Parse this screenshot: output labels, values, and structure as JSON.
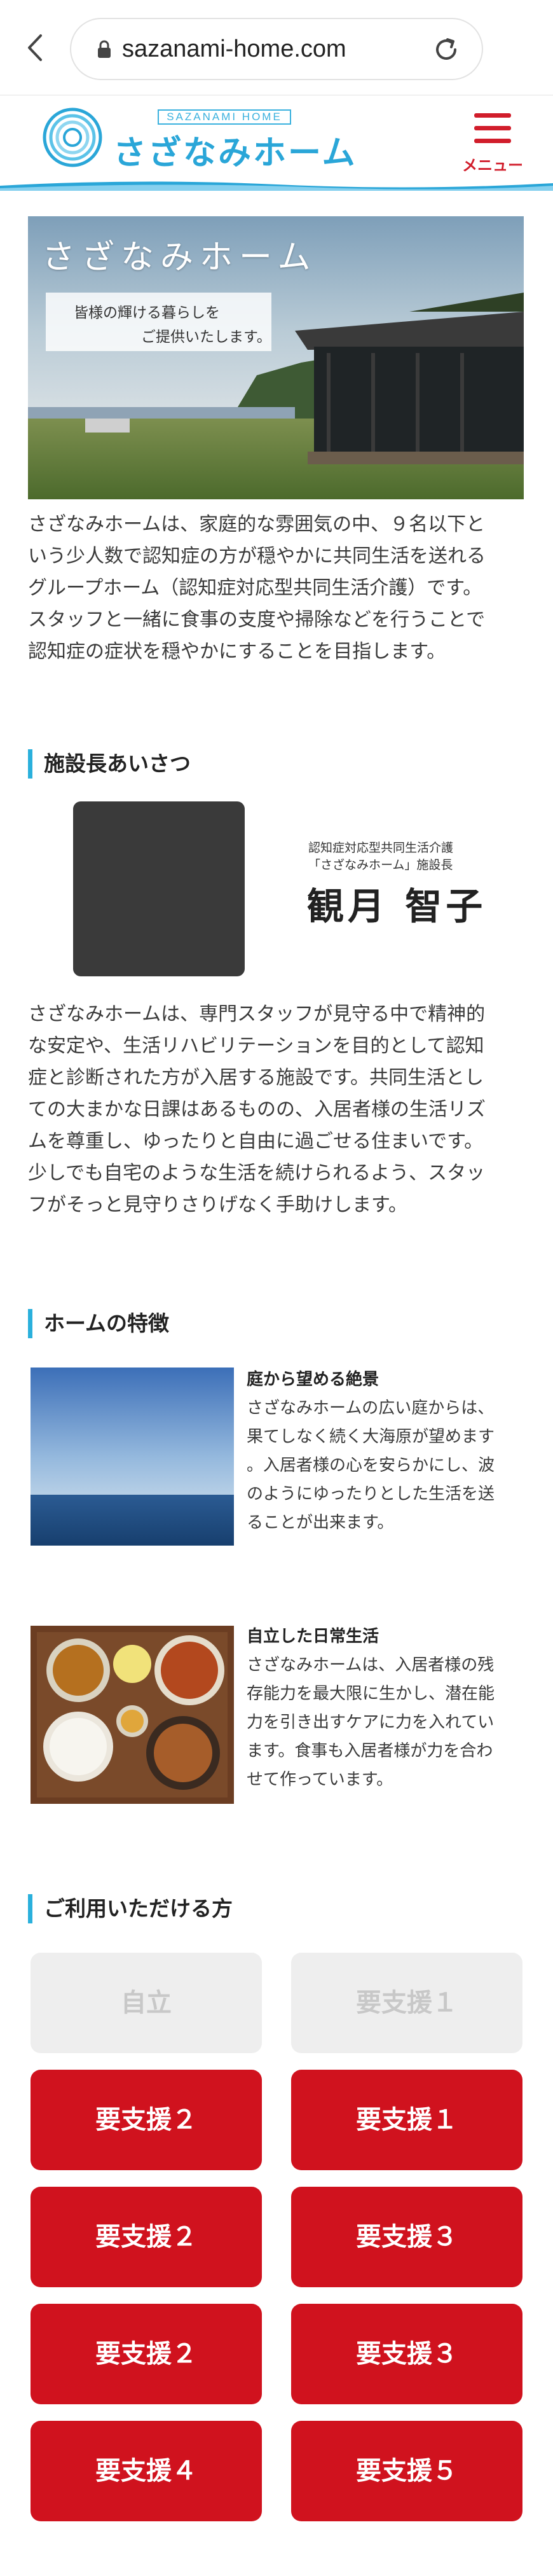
{
  "browser": {
    "url": "sazanami-home.com"
  },
  "header": {
    "logo_en": "SAZANAMI HOME",
    "logo_jp": "さざなみホーム",
    "menu_label": "メニュー"
  },
  "hero": {
    "title": "さざなみホーム",
    "badge_line1": "皆様の輝ける暮らしを",
    "badge_line2": "ご提供いたします。"
  },
  "intro": {
    "lines": [
      "さざなみホームは、家庭的な雰囲気の中、９名以下と",
      "いう少人数で認知症の方が穏やかに共同生活を送れる",
      "グループホーム（認知症対応型共同生活介護）です。",
      "スタッフと一緒に食事の支度や掃除などを行うことで",
      "認知症の症状を穏やかにすることを目指します。"
    ]
  },
  "greeting": {
    "heading": "施設長あいさつ",
    "title_line1": "認知症対応型共同生活介護",
    "title_line2": "「さざなみホーム」施設長",
    "name": "観月 智子",
    "lines": [
      "さざなみホームは、専門スタッフが見守る中で精神的",
      "な安定や、生活リハビリテーションを目的として認知",
      "症と診断された方が入居する施設です。共同生活とし",
      "ての大まかな日課はあるものの、入居者様の生活リズ",
      "ムを尊重し、ゆったりと自由に過ごせる住まいです。",
      "少しでも自宅のような生活を続けられるよう、スタッ",
      "フがそっと見守りさりげなく手助けします。"
    ]
  },
  "features": {
    "heading": "ホームの特徴",
    "items": [
      {
        "title": "庭から望める絶景",
        "lines": [
          "さざなみホームの広い庭からは、",
          "果てしなく続く大海原が望めます",
          "。入居者様の心を安らかにし、波",
          "のようにゆったりとした生活を送",
          "ることが出来ます。"
        ]
      },
      {
        "title": "自立した日常生活",
        "lines": [
          "さざなみホームは、入居者様の残",
          "存能力を最大限に生かし、潜在能",
          "力を引き出すケアに力を入れてい",
          "ます。食事も入居者様が力を合わ",
          "せて作っています。"
        ]
      }
    ]
  },
  "eligibility": {
    "heading": "ご利用いただける方",
    "buttons": [
      {
        "label": "自立",
        "enabled": false
      },
      {
        "label": "要支援１",
        "enabled": false
      },
      {
        "label": "要支援２",
        "enabled": true
      },
      {
        "label": "要支援１",
        "enabled": true
      },
      {
        "label": "要支援２",
        "enabled": true
      },
      {
        "label": "要支援３",
        "enabled": true
      },
      {
        "label": "要支援２",
        "enabled": true
      },
      {
        "label": "要支援３",
        "enabled": true
      },
      {
        "label": "要支援４",
        "enabled": true
      },
      {
        "label": "要支援５",
        "enabled": true
      }
    ]
  },
  "colors": {
    "accent": "#2ab0dc",
    "brand_red": "#d0121e",
    "disabled_bg": "#eeeeee"
  }
}
